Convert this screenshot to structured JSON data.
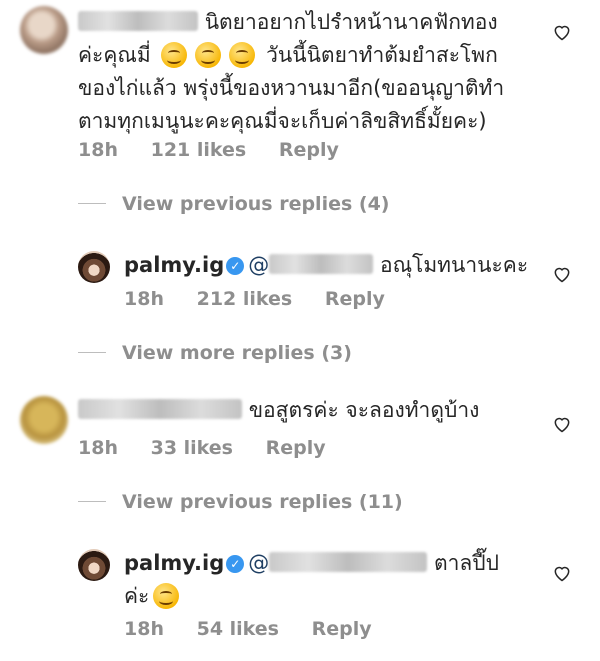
{
  "comments": [
    {
      "line1": "นิตยาอยากไปรำหน้านาคฟักทอง",
      "line2_a": "ค่ะคุณมี่",
      "line2_b": "วันนี้นิตยาทำต้มยำสะโพก",
      "line3": "ของไก่แล้ว พรุ่งนี้ของหวานมาอีก(ขออนุญาติทำ",
      "line4": "ตามทุกเมนูนะคะคุณมี่จะเก็บค่าลิขสิทธิ์มั้ยคะ)",
      "time": "18h",
      "likes": "121 likes",
      "reply": "Reply"
    },
    {
      "username": "palmy.ig",
      "mention_prefix": "@",
      "text": "อณุโมทนานะคะ",
      "time": "18h",
      "likes": "212 likes",
      "reply": "Reply"
    },
    {
      "text": "ขอสูตรค่ะ จะลองทำดูบ้าง",
      "time": "18h",
      "likes": "33 likes",
      "reply": "Reply"
    },
    {
      "username": "palmy.ig",
      "mention_prefix": "@",
      "text_a": "ตาลปี๊ป",
      "text_b": "ค่ะ",
      "time": "18h",
      "likes": "54 likes",
      "reply": "Reply"
    }
  ],
  "view_replies": [
    "View previous replies (4)",
    "View more replies (3)",
    "View previous replies (11)"
  ],
  "icons": {
    "heart": "heart-icon",
    "verified": "verified-badge-icon",
    "emoji": "smiling-face-emoji"
  },
  "colors": {
    "text": "#262626",
    "meta": "#8e8e8e",
    "verified": "#3897f0"
  }
}
